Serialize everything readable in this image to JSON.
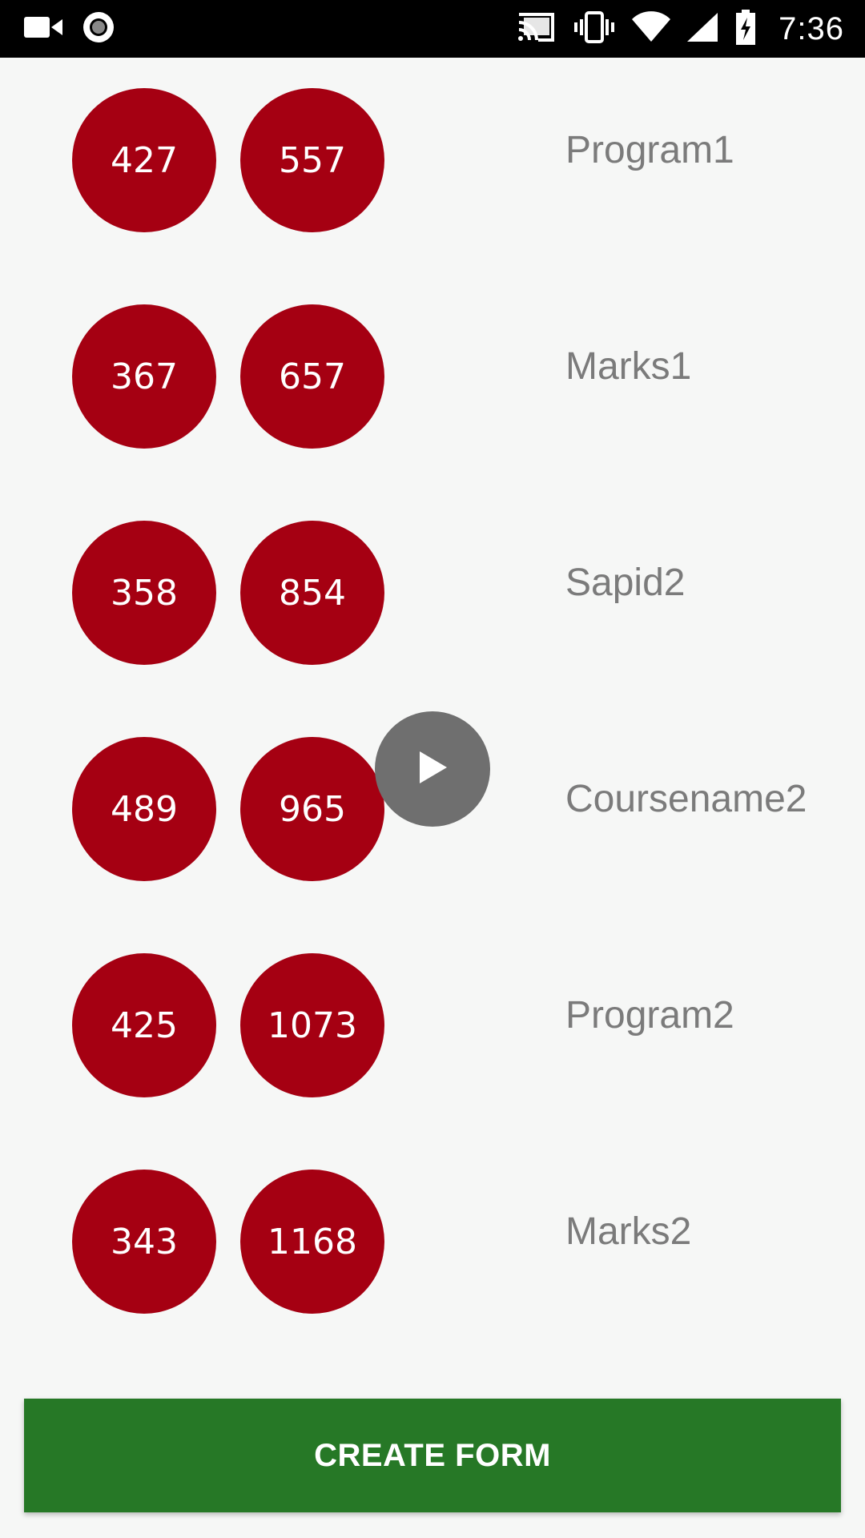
{
  "status_bar": {
    "time": "7:36",
    "icons": [
      "video-camera-icon",
      "record-icon",
      "cast-icon",
      "vibrate-icon",
      "wifi-icon",
      "signal-icon",
      "battery-charging-icon"
    ]
  },
  "rows": [
    {
      "left_value": "427",
      "right_value": "557",
      "label": "Program1"
    },
    {
      "left_value": "367",
      "right_value": "657",
      "label": "Marks1"
    },
    {
      "left_value": "358",
      "right_value": "854",
      "label": "Sapid2"
    },
    {
      "left_value": "489",
      "right_value": "965",
      "label": "Coursename2"
    },
    {
      "left_value": "425",
      "right_value": "1073",
      "label": "Program2"
    },
    {
      "left_value": "343",
      "right_value": "1168",
      "label": "Marks2"
    }
  ],
  "overlay": {
    "icon": "play-icon"
  },
  "create_button": {
    "label": "CREATE FORM"
  },
  "colors": {
    "circle": "#a50012",
    "button": "#267826",
    "background": "#f6f7f6",
    "label": "#7b7b7b"
  }
}
